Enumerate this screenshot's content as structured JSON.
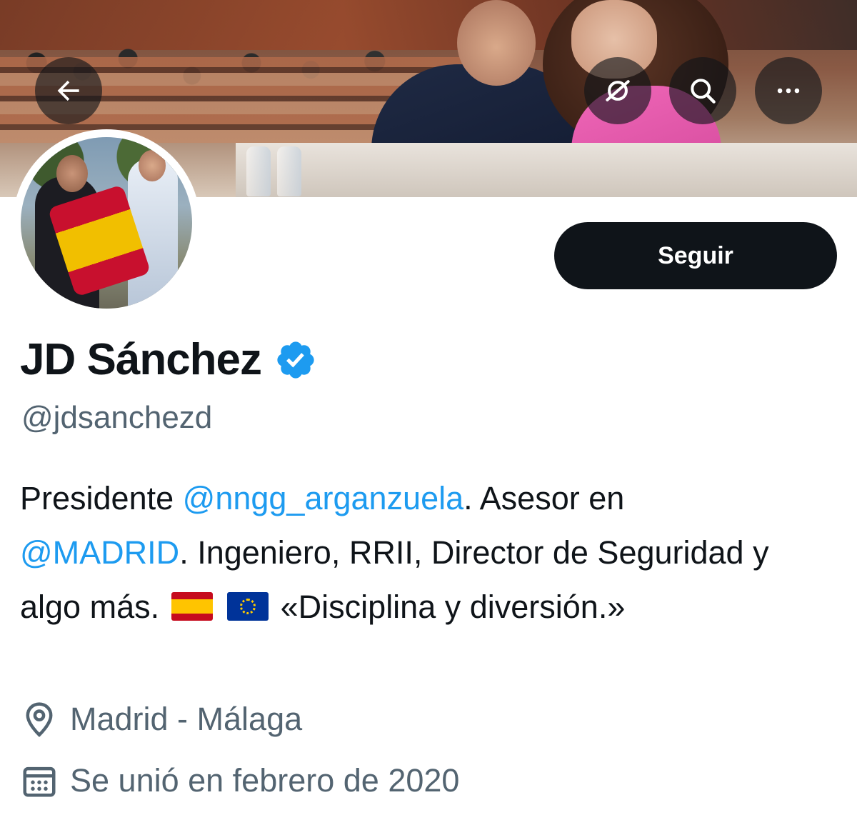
{
  "header": {
    "back_icon": "arrow-left-icon",
    "bot_icon": "grok-icon",
    "search_icon": "search-icon",
    "more_icon": "more-horizontal-icon"
  },
  "profile": {
    "display_name": "JD Sánchez",
    "verified": true,
    "handle": "@jdsanchezd",
    "follow_label": "Seguir",
    "bio": {
      "part1": "Presidente ",
      "mention1": "@nngg_arganzuela",
      "part2": ". Asesor en ",
      "mention2": "@MADRID",
      "part3": ". Ingeniero, RRII, Director de Seguridad y algo más.",
      "part4": " «Disciplina y diversión.»"
    },
    "location": "Madrid - Málaga",
    "joined": "Se unió en febrero de 2020"
  },
  "colors": {
    "link": "#1d9bf0",
    "text": "#0f1419",
    "secondary": "#536471",
    "verified": "#1d9bf0"
  }
}
